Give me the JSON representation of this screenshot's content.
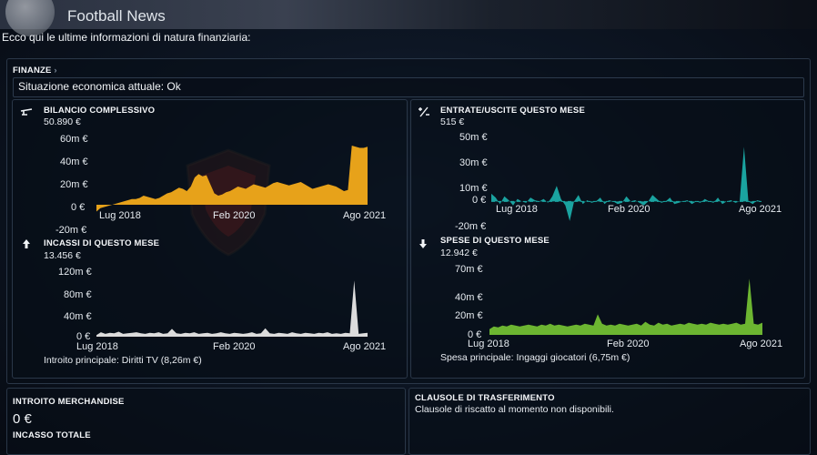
{
  "header": {
    "title": "Football News"
  },
  "intro": "Ecco qui le ultime informazioni di natura finanziaria:",
  "finanze": {
    "title": "FINANZE",
    "chevron": "›",
    "status": "Situazione economica attuale: Ok"
  },
  "colors": {
    "bilancio": "#e7a21a",
    "entrate": "#1aa3a0",
    "incassi": "#dcdcdc",
    "spese": "#6cb531"
  },
  "charts": {
    "bilancio": {
      "icon": "scale-icon",
      "title": "BILANCIO COMPLESSIVO",
      "value": "50.890 €",
      "y_ticks": [
        "60m €",
        "40m €",
        "20m €",
        "0 €",
        "-20m €"
      ],
      "x_ticks": [
        "Lug 2018",
        "Feb 2020",
        "Ago 2021"
      ]
    },
    "entrate": {
      "icon": "plus-minus-icon",
      "title": "ENTRATE/USCITE QUESTO MESE",
      "value": "515 €",
      "y_ticks": [
        "50m €",
        "30m €",
        "10m €",
        "0 €",
        "-20m €"
      ],
      "x_ticks": [
        "Lug 2018",
        "Feb 2020",
        "Ago 2021"
      ]
    },
    "incassi": {
      "icon": "arrow-up-icon",
      "title": "INCASSI DI QUESTO MESE",
      "value": "13.456 €",
      "y_ticks": [
        "120m €",
        "80m €",
        "40m €",
        "0 €"
      ],
      "x_ticks": [
        "Lug 2018",
        "Feb 2020",
        "Ago 2021"
      ],
      "footer": "Introito principale:  Diritti TV (8,26m €)"
    },
    "spese": {
      "icon": "arrow-down-icon",
      "title": "SPESE DI QUESTO MESE",
      "value": "12.942 €",
      "y_ticks": [
        "70m €",
        "40m €",
        "20m €",
        "0 €"
      ],
      "x_ticks": [
        "Lug 2018",
        "Feb 2020",
        "Ago 2021"
      ],
      "footer": "Spesa principale:  Ingaggi giocatori (6,75m €)"
    }
  },
  "chart_data": [
    {
      "type": "area",
      "title": "BILANCIO COMPLESSIVO",
      "x_range": [
        "Lug 2018",
        "Ago 2021"
      ],
      "ylim": [
        -20,
        60
      ],
      "y_unit": "m €",
      "series": [
        {
          "values": [
            -6,
            -3,
            -2,
            -1,
            0,
            1,
            2,
            3,
            4,
            5,
            5,
            6,
            8,
            7,
            6,
            5,
            6,
            8,
            10,
            11,
            13,
            15,
            14,
            12,
            16,
            24,
            27,
            25,
            26,
            18,
            10,
            8,
            9,
            11,
            12,
            14,
            16,
            15,
            14,
            16,
            18,
            17,
            16,
            15,
            17,
            19,
            20,
            19,
            18,
            17,
            18,
            19,
            20,
            18,
            16,
            14,
            15,
            16,
            17,
            18,
            17,
            16,
            14,
            12,
            13,
            52,
            51,
            50,
            50,
            51
          ]
        }
      ]
    },
    {
      "type": "area",
      "title": "ENTRATE/USCITE QUESTO MESE",
      "x_range": [
        "Lug 2018",
        "Ago 2021"
      ],
      "ylim": [
        -20,
        50
      ],
      "y_unit": "m €",
      "series": [
        {
          "values": [
            6,
            3,
            -2,
            4,
            1,
            -3,
            2,
            0,
            -1,
            3,
            1,
            0,
            2,
            -1,
            4,
            12,
            2,
            -3,
            -15,
            0,
            5,
            -2,
            1,
            -1,
            0,
            3,
            -2,
            1,
            0,
            -2,
            -1,
            4,
            0,
            1,
            -1,
            -3,
            0,
            5,
            2,
            -1,
            0,
            3,
            -2,
            -1,
            0,
            1,
            -2,
            0,
            -1,
            2,
            0,
            -1,
            3,
            -2,
            0,
            1,
            -1,
            0,
            42,
            0,
            -2,
            1,
            0
          ]
        }
      ]
    },
    {
      "type": "area",
      "title": "INCASSI DI QUESTO MESE",
      "x_range": [
        "Lug 2018",
        "Ago 2021"
      ],
      "ylim": [
        0,
        120
      ],
      "y_unit": "m €",
      "series": [
        {
          "values": [
            3,
            8,
            5,
            7,
            6,
            9,
            5,
            6,
            7,
            8,
            6,
            5,
            7,
            6,
            8,
            5,
            6,
            14,
            6,
            5,
            7,
            6,
            8,
            5,
            6,
            7,
            5,
            6,
            8,
            6,
            5,
            7,
            6,
            5,
            6,
            8,
            5,
            6,
            15,
            6,
            5,
            7,
            6,
            5,
            8,
            6,
            5,
            7,
            6,
            5,
            7,
            6,
            8,
            5,
            6,
            5,
            7,
            6,
            100,
            5,
            6,
            7
          ]
        }
      ]
    },
    {
      "type": "area",
      "title": "SPESE DI QUESTO MESE",
      "x_range": [
        "Lug 2018",
        "Ago 2021"
      ],
      "ylim": [
        0,
        70
      ],
      "y_unit": "m €",
      "series": [
        {
          "values": [
            6,
            9,
            8,
            10,
            9,
            11,
            10,
            9,
            10,
            11,
            10,
            9,
            11,
            10,
            12,
            10,
            11,
            10,
            9,
            10,
            11,
            10,
            12,
            11,
            10,
            22,
            12,
            10,
            11,
            10,
            12,
            11,
            10,
            11,
            12,
            10,
            14,
            11,
            10,
            13,
            11,
            12,
            10,
            11,
            12,
            11,
            13,
            12,
            11,
            12,
            11,
            13,
            12,
            11,
            12,
            11,
            12,
            13,
            11,
            12,
            60,
            12,
            11,
            13
          ]
        }
      ]
    }
  ],
  "merchandise": {
    "title": "INTROITO MERCHANDISE",
    "value": "0 €",
    "total_label": "INCASSO TOTALE"
  },
  "clausole": {
    "title": "CLAUSOLE DI TRASFERIMENTO",
    "text": "Clausole di riscatto al momento non disponibili."
  }
}
